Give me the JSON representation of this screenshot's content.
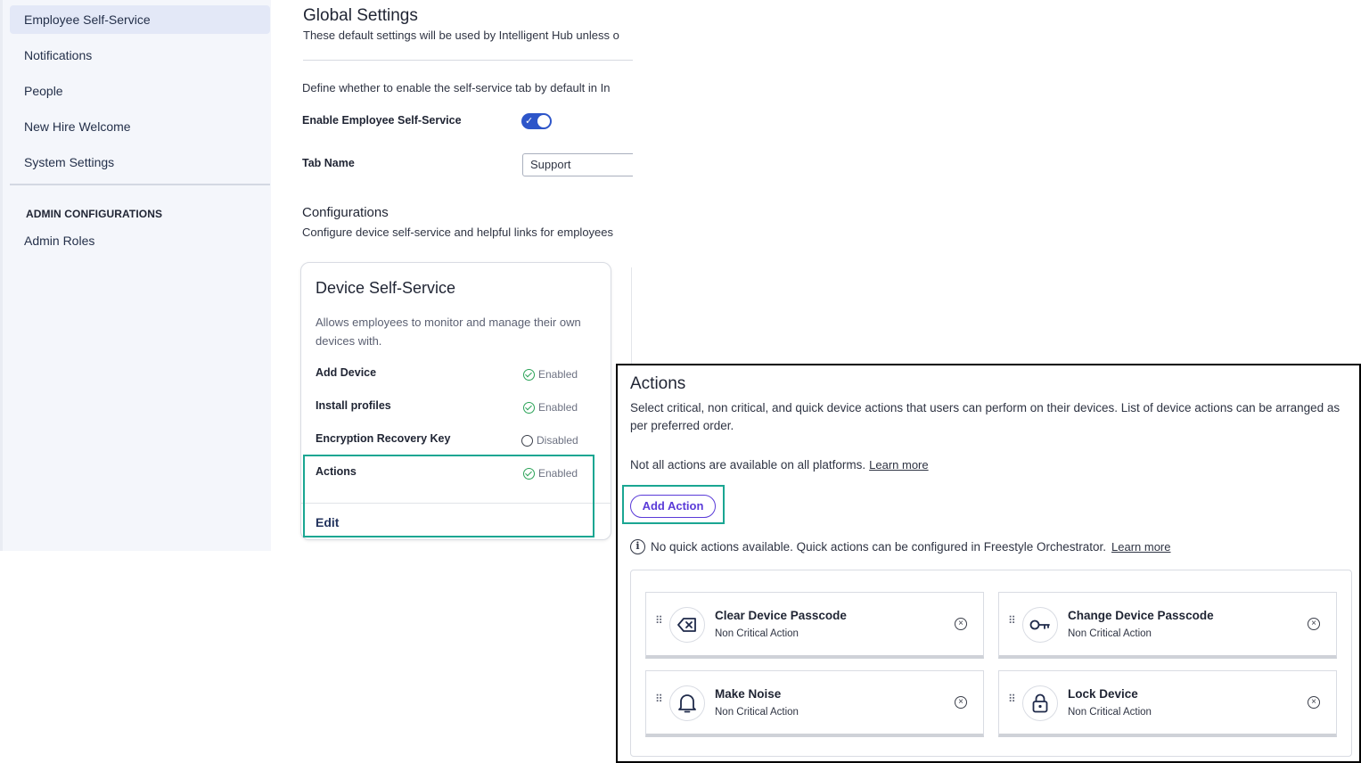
{
  "sidebar": {
    "items": [
      {
        "label": "Employee Self-Service"
      },
      {
        "label": "Notifications"
      },
      {
        "label": "People"
      },
      {
        "label": "New Hire Welcome"
      },
      {
        "label": "System Settings"
      }
    ],
    "admin_heading": "ADMIN CONFIGURATIONS",
    "admin_items": [
      {
        "label": "Admin Roles"
      }
    ]
  },
  "global": {
    "title": "Global Settings",
    "subtitle": "These default settings will be used by Intelligent Hub unless o",
    "define_text": "Define whether to enable the self-service tab by default in In",
    "enable_label": "Enable Employee Self-Service",
    "enable_checked": true,
    "tab_name_label": "Tab Name",
    "tab_name_value": "Support"
  },
  "configurations": {
    "title": "Configurations",
    "subtitle": "Configure device self-service and helpful links for employees"
  },
  "device_card": {
    "title": "Device Self-Service",
    "description": "Allows employees to monitor and manage their own devices with.",
    "rows": [
      {
        "label": "Add Device",
        "status": "Enabled"
      },
      {
        "label": "Install profiles",
        "status": "Enabled"
      },
      {
        "label": "Encryption Recovery Key",
        "status": "Disabled"
      },
      {
        "label": "Actions",
        "status": "Enabled"
      }
    ],
    "edit_label": "Edit"
  },
  "actions_panel": {
    "title": "Actions",
    "description": "Select critical, non critical, and quick device actions that users can perform on their devices. List of device actions can be arranged as per preferred order.",
    "note": "Not all actions are available on all platforms.",
    "note_link": "Learn more",
    "add_button": "Add Action",
    "info_text": "No quick actions available. Quick actions can be configured in Freestyle Orchestrator.",
    "info_link": "Learn more",
    "actions": [
      {
        "name": "Clear Device Passcode",
        "type": "Non Critical Action",
        "icon": "clear-passcode-icon"
      },
      {
        "name": "Change Device Passcode",
        "type": "Non Critical Action",
        "icon": "key-icon"
      },
      {
        "name": "Make Noise",
        "type": "Non Critical Action",
        "icon": "bell-icon"
      },
      {
        "name": "Lock Device",
        "type": "Non Critical Action",
        "icon": "lock-icon"
      }
    ]
  },
  "colors": {
    "accent": "#2d55c9",
    "highlight": "#1aa692",
    "button": "#5a3bd8",
    "enabled": "#2aa257"
  }
}
